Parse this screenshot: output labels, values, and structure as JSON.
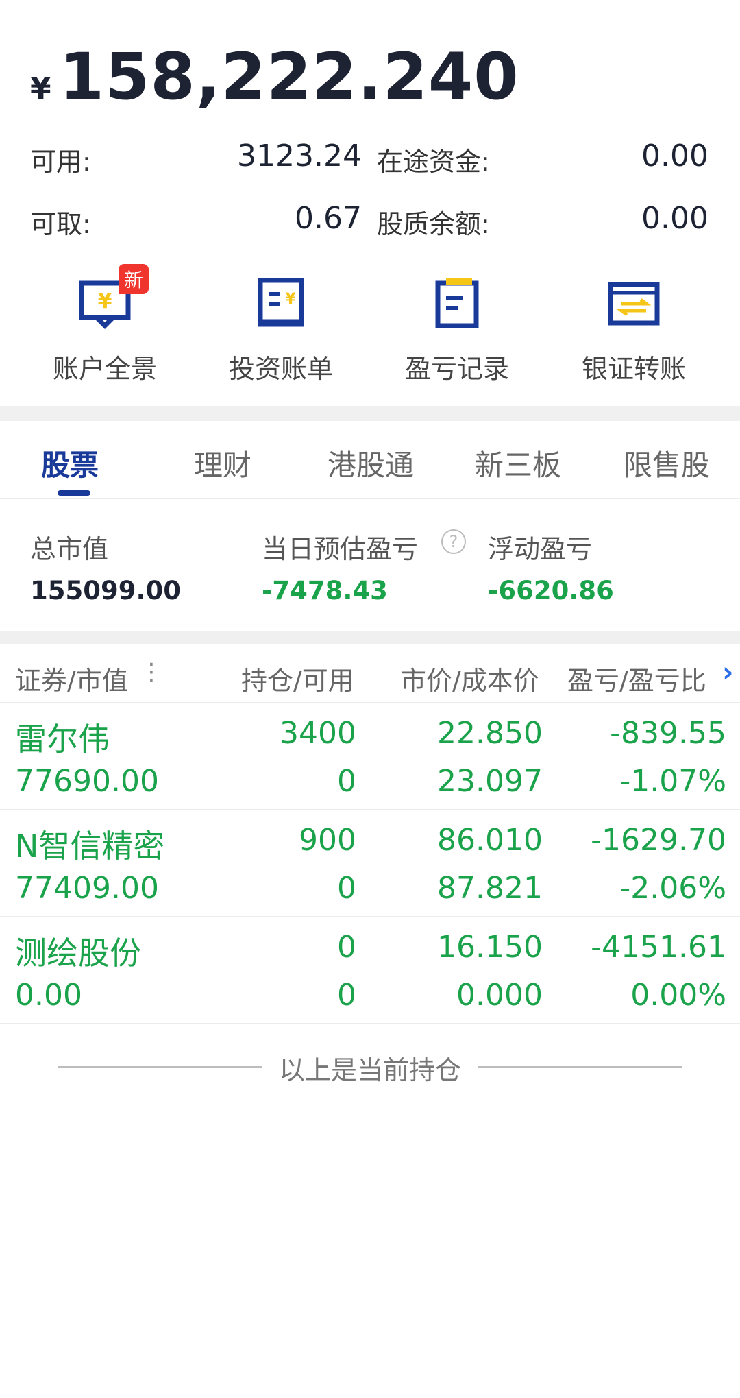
{
  "header": {
    "currency": "¥",
    "total_assets": "158,222.240",
    "available_label": "可用:",
    "available_value": "3123.24",
    "in_transit_label": "在途资金:",
    "in_transit_value": "0.00",
    "withdrawable_label": "可取:",
    "withdrawable_value": "0.67",
    "pledge_label": "股质余额:",
    "pledge_value": "0.00"
  },
  "quick_actions": [
    {
      "label": "账户全景",
      "icon": "account-overview-icon",
      "badge": "新"
    },
    {
      "label": "投资账单",
      "icon": "investment-bill-icon"
    },
    {
      "label": "盈亏记录",
      "icon": "profit-record-icon"
    },
    {
      "label": "银证转账",
      "icon": "bank-transfer-icon"
    }
  ],
  "tabs": [
    {
      "label": "股票",
      "active": true
    },
    {
      "label": "理财"
    },
    {
      "label": "港股通"
    },
    {
      "label": "新三板"
    },
    {
      "label": "限售股"
    }
  ],
  "summary": {
    "market_value_label": "总市值",
    "market_value": "155099.00",
    "daily_pnl_label": "当日预估盈亏",
    "daily_pnl": "-7478.43",
    "floating_pnl_label": "浮动盈亏",
    "floating_pnl": "-6620.86"
  },
  "table": {
    "headers": [
      "证券/市值",
      "持仓/可用",
      "市价/成本价",
      "盈亏/盈亏比"
    ],
    "rows": [
      {
        "name": "雷尔伟",
        "value": "77690.00",
        "position": "3400",
        "available": "0",
        "price": "22.850",
        "cost": "23.097",
        "pnl": "-839.55",
        "pnl_ratio": "-1.07%"
      },
      {
        "name": "N智信精密",
        "value": "77409.00",
        "position": "900",
        "available": "0",
        "price": "86.010",
        "cost": "87.821",
        "pnl": "-1629.70",
        "pnl_ratio": "-2.06%"
      },
      {
        "name": "测绘股份",
        "value": "0.00",
        "position": "0",
        "available": "0",
        "price": "16.150",
        "cost": "0.000",
        "pnl": "-4151.61",
        "pnl_ratio": "0.00%"
      }
    ]
  },
  "footer": {
    "text": "以上是当前持仓"
  },
  "colors": {
    "accent": "#1a3a9a",
    "gain_loss": "#1aa34a",
    "badge": "#f0342e",
    "icon_yellow": "#f5c518"
  }
}
